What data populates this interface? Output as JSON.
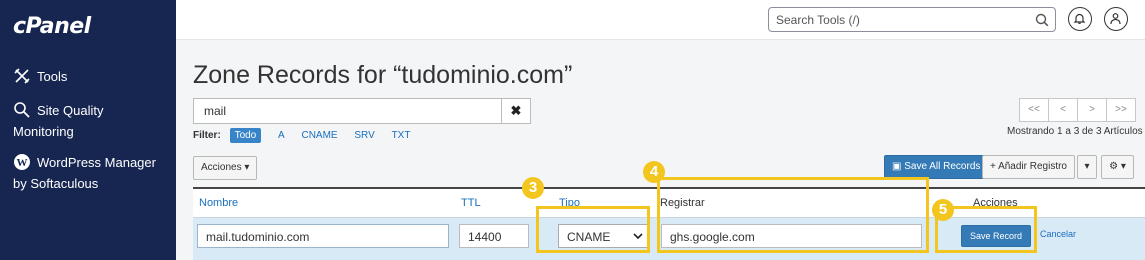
{
  "sidebar": {
    "logo": "cPanel",
    "items": [
      {
        "label": "Tools",
        "icon": "tools-icon"
      },
      {
        "label": "Site Quality Monitoring",
        "icon": "magnifier-icon"
      },
      {
        "label": "WordPress Manager by Softaculous",
        "icon": "wordpress-icon"
      }
    ]
  },
  "topbar": {
    "search_placeholder": "Search Tools (/)"
  },
  "page": {
    "title": "Zone Records for “tudominio.com”",
    "filter_value": "mail",
    "filter_clear": "✖",
    "filter_label": "Filter:",
    "filters": [
      "Todo",
      "A",
      "CNAME",
      "SRV",
      "TXT"
    ],
    "active_filter": "Todo",
    "pager": [
      "<<",
      "<",
      ">",
      ">>"
    ],
    "showing": "Mostrando 1 a 3 de 3 Artículos"
  },
  "toolbar": {
    "acciones": "Acciones ▾",
    "save_all": "Save All Records",
    "add_record": "+ Añadir Registro",
    "add_caret": "▾",
    "gear": "⚙ ▾"
  },
  "table": {
    "headers": {
      "name": "Nombre",
      "ttl": "TTL",
      "type": "Tipo",
      "record": "Registrar",
      "actions": "Acciones"
    },
    "row": {
      "name": "mail.tudominio.com",
      "ttl": "14400",
      "type": "CNAME",
      "record": "ghs.google.com",
      "save": "Save Record",
      "cancel": "Cancelar"
    }
  },
  "annotations": [
    "3",
    "4",
    "5"
  ],
  "colors": {
    "sidebar": "#172651",
    "accent": "#337ab7",
    "highlight": "#f2c61f",
    "row": "#d9eaf7"
  }
}
